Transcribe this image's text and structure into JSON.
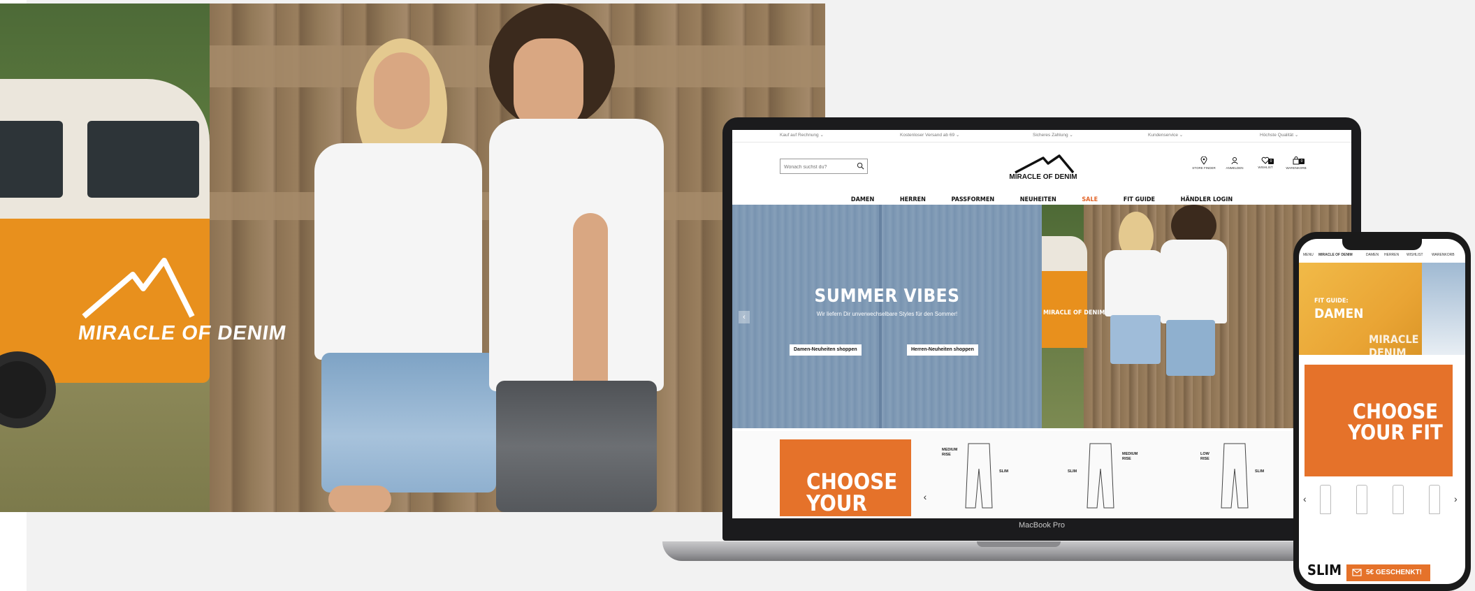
{
  "photo": {
    "van_brand": "MIRACLE OF DENIM"
  },
  "laptop": {
    "label": "MacBook Pro",
    "topbar": [
      "Kauf auf Rechnung ⌄",
      "Kostenloser Versand ab 69 ⌄",
      "Sicheres Zahlung ⌄",
      "Kundenservice ⌄",
      "Höchste Qualität ⌄"
    ],
    "search": {
      "placeholder": "Wonach suchst du?"
    },
    "logo": "MIRACLE OF DENIM",
    "user_icons": [
      "STORE FINDER",
      "ANMELDEN",
      "WISHLIST",
      "WARENKORB"
    ],
    "wishlist_count": "0",
    "cart_count": "0",
    "nav": [
      "DAMEN",
      "HERREN",
      "PASSFORMEN",
      "NEUHEITEN",
      "SALE",
      "FIT GUIDE",
      "HÄNDLER LOGIN"
    ],
    "hero": {
      "title": "SUMMER VIBES",
      "subtitle": "Wir liefern Dir unverwechselbare Styles für den Sommer!",
      "button_women": "Damen-Neuheiten shoppen",
      "button_men": "Herren-Neuheiten shoppen",
      "arrow": "‹",
      "brand": "MIRACLE OF DENIM"
    },
    "fit": {
      "title": "CHOOSE YOUR",
      "arrow_left": "‹",
      "arrow_right": "›",
      "items": [
        {
          "rise": "MEDIUM RISE",
          "fit": "SLIM"
        },
        {
          "rise": "MEDIUM RISE",
          "fit": "SLIM"
        },
        {
          "rise": "LOW RISE",
          "fit": "SLIM"
        }
      ]
    }
  },
  "phone": {
    "nav": [
      "MENU",
      "MIRACLE OF DENIM",
      "DAMEN",
      "HERREN",
      "WISHLIST",
      "WARENKORB"
    ],
    "banner_small": "FIT GUIDE:",
    "banner_large": "DAMEN",
    "banner_brand": "MIRACLE OF DENIM",
    "choose": "CHOOSE YOUR FIT",
    "fit_arrow_left": "‹",
    "fit_arrow_right": "›",
    "bottom_text": "SLIM FIT",
    "gift_button": "5€ GESCHENKT!"
  },
  "colors": {
    "accent": "#e5722a",
    "van_orange": "#e8901d",
    "background": "#f2f2f2"
  }
}
